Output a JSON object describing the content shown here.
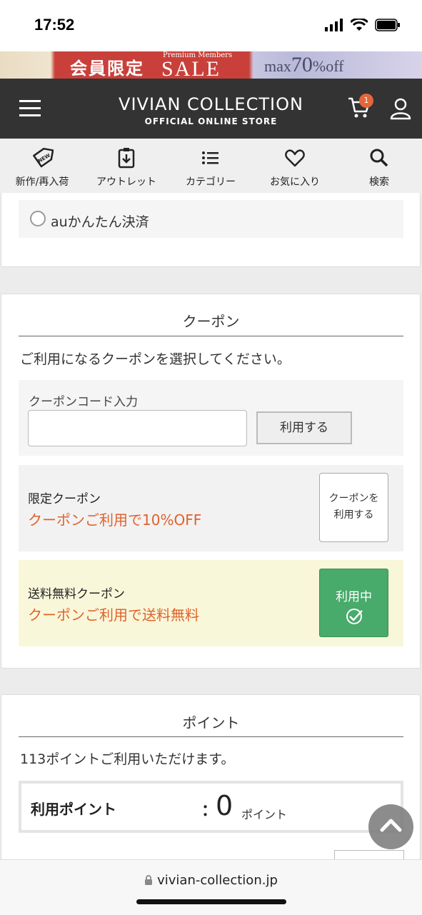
{
  "status_bar": {
    "time": "17:52"
  },
  "banner": {
    "members_only": "会員限定",
    "premium_members": "Premium Members",
    "sale": "SALE",
    "max": "max",
    "percent": "70",
    "off": "%off",
    "colors": {
      "left": "#efe4cf",
      "center": "#c9403a",
      "right": "#c7c6e0"
    }
  },
  "header": {
    "brand": "VIVIAN COLLECTION",
    "subtitle": "OFFICIAL ONLINE STORE",
    "cart_count": "1",
    "background": "#333333"
  },
  "nav": {
    "items": [
      {
        "label": "新作/再入荷",
        "icon": "new-tag-icon"
      },
      {
        "label": "アウトレット",
        "icon": "outlet-icon"
      },
      {
        "label": "カテゴリー",
        "icon": "list-icon"
      },
      {
        "label": "お気に入り",
        "icon": "heart-icon"
      },
      {
        "label": "検索",
        "icon": "search-icon"
      }
    ]
  },
  "payment": {
    "option_label": "auかんたん決済",
    "selected": false
  },
  "coupon": {
    "title": "クーポン",
    "instruction": "ご利用になるクーポンを選択してください。",
    "code_label": "クーポンコード入力",
    "code_value": "",
    "apply_label": "利用する",
    "items": [
      {
        "name": "限定クーポン",
        "description": "クーポンご利用で10%OFF",
        "button_line1": "クーポンを",
        "button_line2": "利用する",
        "in_use": false
      },
      {
        "name": "送料無料クーポン",
        "description": "クーポンご利用で送料無料",
        "button_line1": "利用中",
        "in_use": true
      }
    ],
    "accent_color": "#e0622c",
    "in_use_color": "#48aa6b",
    "highlight_bg": "#f9f7d9"
  },
  "points": {
    "title": "ポイント",
    "available_text": "113ポイントご利用いただけます。",
    "use_label": "利用ポイント",
    "colon": "：",
    "value": "0",
    "unit": "ポイント"
  },
  "browser": {
    "url": "vivian-collection.jp"
  }
}
